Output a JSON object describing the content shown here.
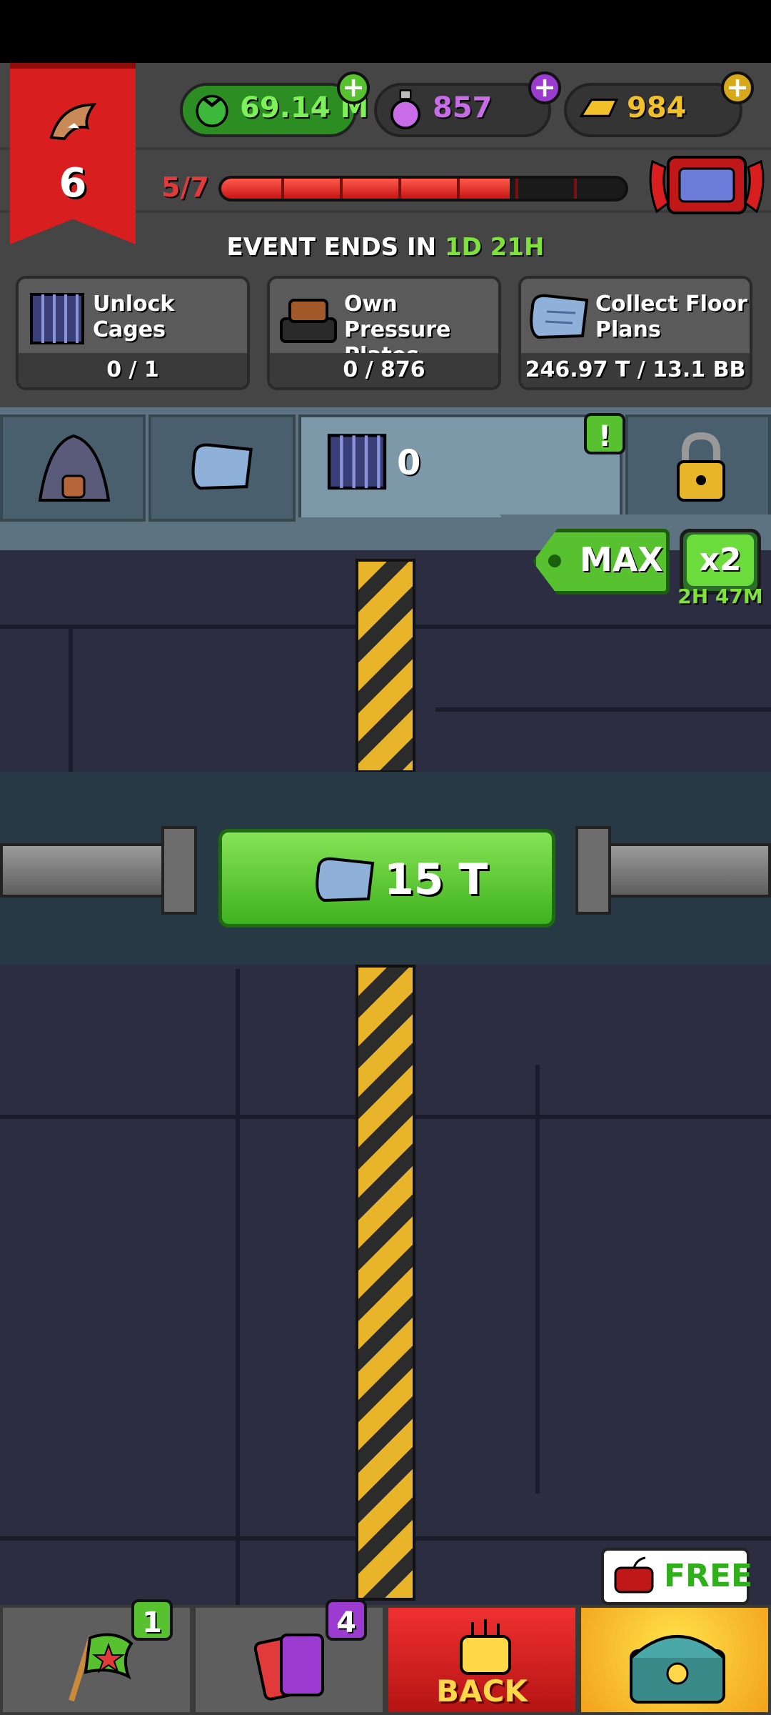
{
  "player": {
    "level": "6"
  },
  "currencies": {
    "cash": "69.14 M",
    "potion": "857",
    "gold": "984"
  },
  "progress": {
    "label": "5/7",
    "fraction": 0.714
  },
  "event": {
    "title": "EVENT ENDS IN",
    "time": "1D 21H"
  },
  "tasks": [
    {
      "label": "Unlock Cages",
      "value": "0 / 1"
    },
    {
      "label": "Own Pressure Plates",
      "value": "0 / 876"
    },
    {
      "label": "Collect Floor Plans",
      "value": "246.97 T / 13.1 BB"
    }
  ],
  "tabs": {
    "active_count": "0",
    "alert": "!"
  },
  "max_button": {
    "label": "MAX"
  },
  "boost": {
    "label": "x2",
    "time": "2H 47M"
  },
  "purchase": {
    "price": "15 T"
  },
  "bottom_nav": {
    "flag_badge": "1",
    "cards_badge": "4",
    "back_label": "BACK",
    "free_label": "FREE"
  },
  "colors": {
    "accent_green": "#57c12f",
    "danger_red": "#d81e1e",
    "gold": "#ffd84a"
  }
}
